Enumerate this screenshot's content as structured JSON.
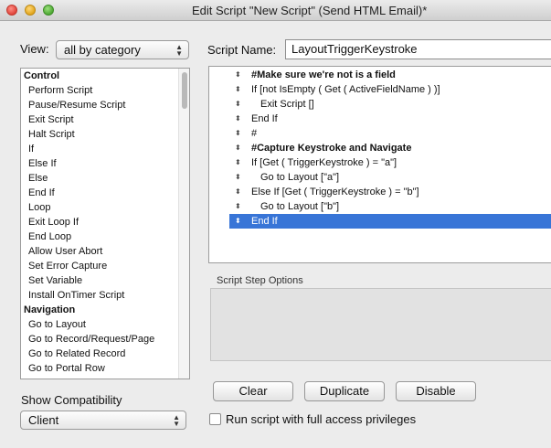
{
  "window": {
    "title": "Edit Script \"New Script\" (Send HTML Email)*"
  },
  "view": {
    "label": "View:",
    "selected": "all by category"
  },
  "script_name": {
    "label": "Script Name:",
    "value": "LayoutTriggerKeystroke"
  },
  "step_list": [
    {
      "text": "Control",
      "category": true
    },
    {
      "text": "Perform Script",
      "category": false
    },
    {
      "text": "Pause/Resume Script",
      "category": false
    },
    {
      "text": "Exit Script",
      "category": false
    },
    {
      "text": "Halt Script",
      "category": false
    },
    {
      "text": "If",
      "category": false
    },
    {
      "text": "Else If",
      "category": false
    },
    {
      "text": "Else",
      "category": false
    },
    {
      "text": "End If",
      "category": false
    },
    {
      "text": "Loop",
      "category": false
    },
    {
      "text": "Exit Loop If",
      "category": false
    },
    {
      "text": "End Loop",
      "category": false
    },
    {
      "text": "Allow User Abort",
      "category": false
    },
    {
      "text": "Set Error Capture",
      "category": false
    },
    {
      "text": "Set Variable",
      "category": false
    },
    {
      "text": "Install OnTimer Script",
      "category": false
    },
    {
      "text": "Navigation",
      "category": true
    },
    {
      "text": "Go to Layout",
      "category": false
    },
    {
      "text": "Go to Record/Request/Page",
      "category": false
    },
    {
      "text": "Go to Related Record",
      "category": false
    },
    {
      "text": "Go to Portal Row",
      "category": false
    }
  ],
  "script_lines": [
    {
      "text": "#Make sure we're not is a field",
      "indent": 0,
      "bold": true,
      "selected": false
    },
    {
      "text": "If [not IsEmpty ( Get ( ActiveFieldName ) )]",
      "indent": 0,
      "bold": false,
      "selected": false
    },
    {
      "text": "Exit Script []",
      "indent": 1,
      "bold": false,
      "selected": false
    },
    {
      "text": "End If",
      "indent": 0,
      "bold": false,
      "selected": false
    },
    {
      "text": "#",
      "indent": 0,
      "bold": false,
      "selected": false
    },
    {
      "text": "#Capture Keystroke and Navigate",
      "indent": 0,
      "bold": true,
      "selected": false
    },
    {
      "text": "If [Get ( TriggerKeystroke ) = \"a\"]",
      "indent": 0,
      "bold": false,
      "selected": false
    },
    {
      "text": "Go to Layout [\"a\"]",
      "indent": 1,
      "bold": false,
      "selected": false
    },
    {
      "text": "Else If [Get ( TriggerKeystroke ) = \"b\"]",
      "indent": 0,
      "bold": false,
      "selected": false
    },
    {
      "text": "Go to Layout [\"b\"]",
      "indent": 1,
      "bold": false,
      "selected": false
    },
    {
      "text": "End If",
      "indent": 0,
      "bold": false,
      "selected": true
    }
  ],
  "options": {
    "label": "Script Step Options"
  },
  "buttons": {
    "clear": "Clear",
    "duplicate": "Duplicate",
    "disable": "Disable"
  },
  "compatibility": {
    "label": "Show Compatibility",
    "selected": "Client"
  },
  "full_access": {
    "label": "Run script with full access privileges",
    "checked": false
  },
  "colors": {
    "selection": "#3875d7"
  }
}
